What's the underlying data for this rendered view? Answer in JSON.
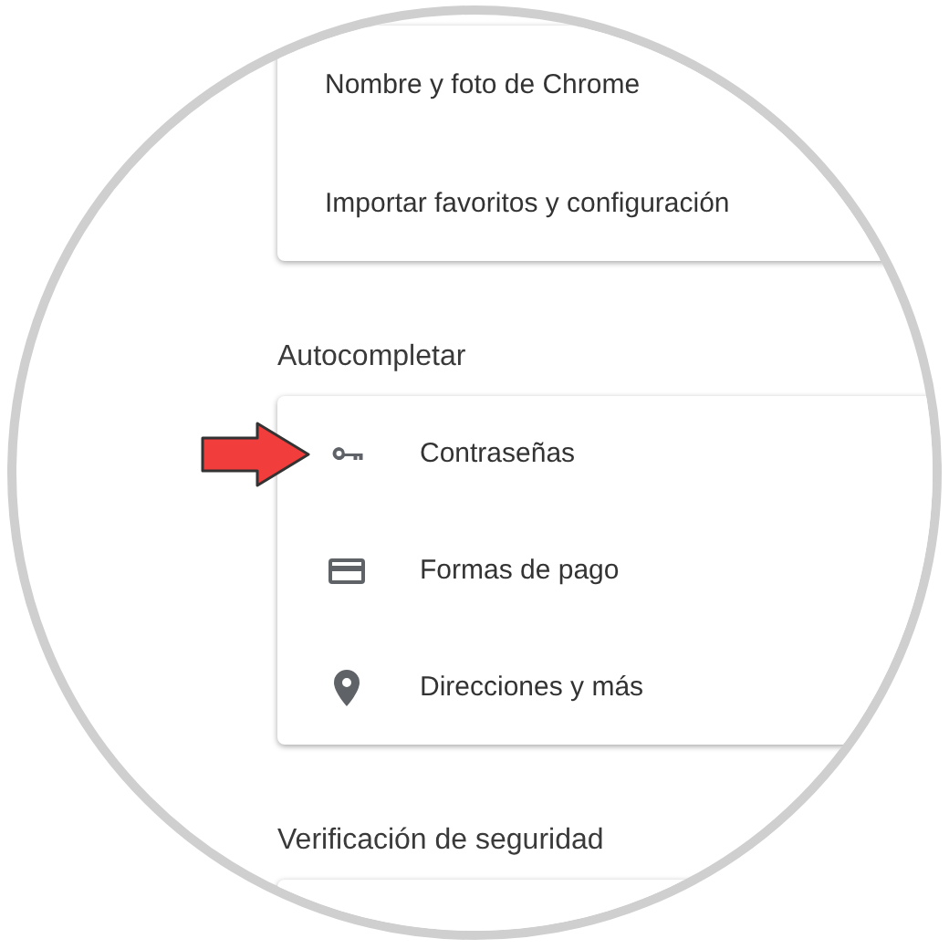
{
  "sections": [
    {
      "items": [
        {
          "label": "Nombre y foto de Chrome",
          "annotated": false
        },
        {
          "label": "Importar favoritos y configuración",
          "annotated": false
        }
      ]
    },
    {
      "title": "Autocompletar",
      "items": [
        {
          "kind": "key",
          "label": "Contraseñas",
          "annotated": true
        },
        {
          "kind": "card",
          "label": "Formas de pago",
          "annotated": false
        },
        {
          "kind": "pin",
          "label": "Direcciones y más",
          "annotated": false
        }
      ]
    },
    {
      "title": "Verificación de seguridad"
    }
  ]
}
